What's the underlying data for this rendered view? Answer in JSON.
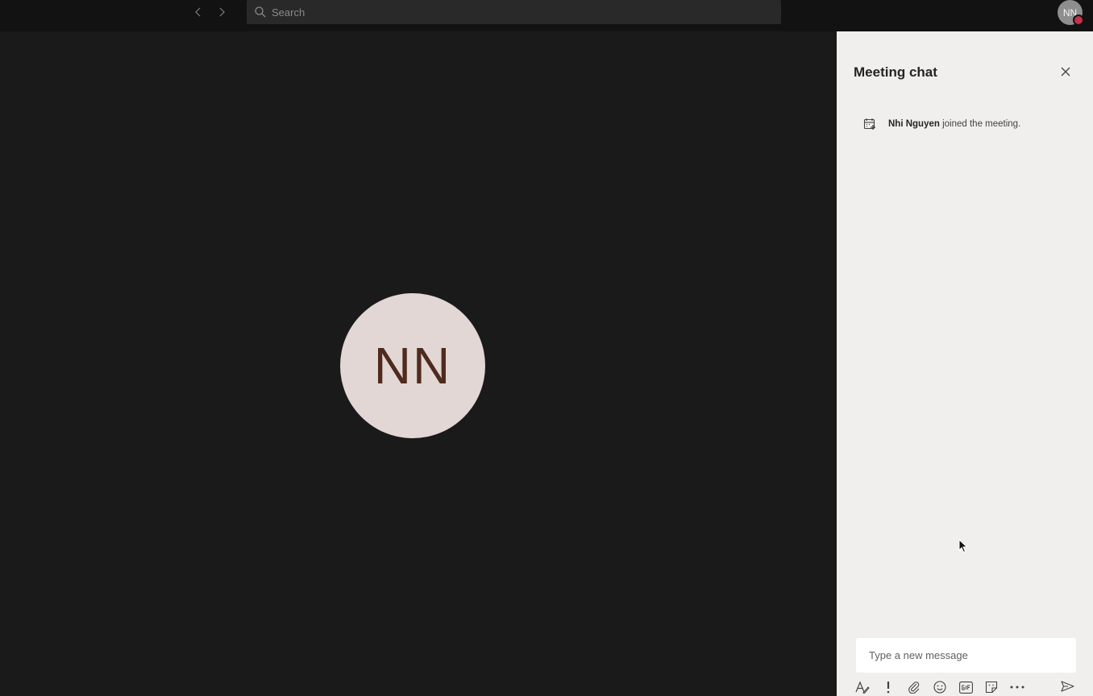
{
  "topbar": {
    "search": {
      "placeholder": "Search",
      "value": ""
    },
    "profile_initials": "NN",
    "presence_color": "#c4314b"
  },
  "stage": {
    "participant_initials": "NN",
    "avatar_bg": "#e2d7d5",
    "avatar_fg": "#4f2b1e"
  },
  "chat": {
    "title": "Meeting chat",
    "events": [
      {
        "name": "Nhi Nguyen",
        "text": " joined the meeting."
      }
    ],
    "composer": {
      "placeholder": "Type a new message",
      "value": ""
    },
    "toolbar_icons": [
      "format-icon",
      "important-icon",
      "attach-icon",
      "emoji-icon",
      "gif-icon",
      "sticker-icon",
      "more-options-icon",
      "send-icon"
    ]
  }
}
